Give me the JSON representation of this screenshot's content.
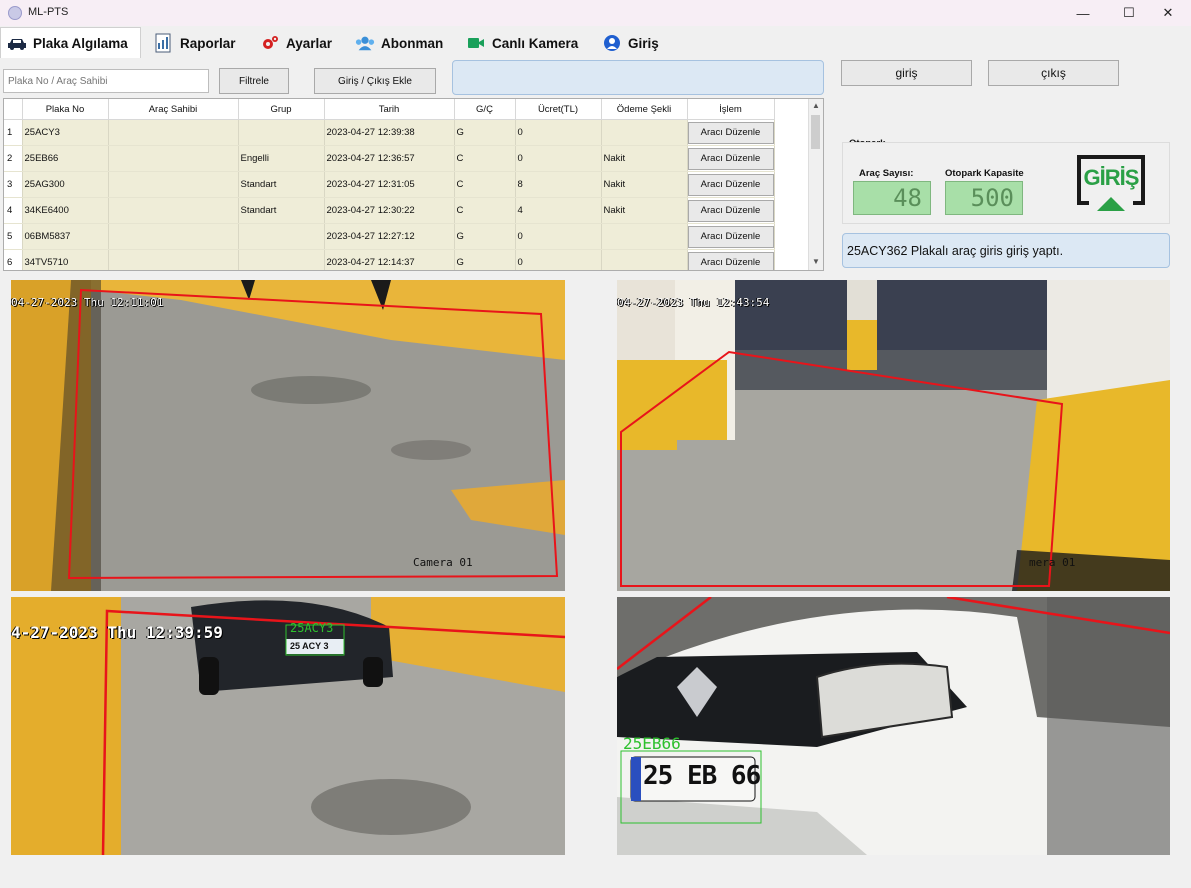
{
  "window": {
    "title": "ML-PTS",
    "minimize": "—",
    "maximize": "☐",
    "close": "✕"
  },
  "tabs": [
    {
      "label": "Plaka Algılama"
    },
    {
      "label": "Raporlar"
    },
    {
      "label": "Ayarlar"
    },
    {
      "label": "Abonman"
    },
    {
      "label": "Canlı Kamera"
    },
    {
      "label": "Giriş"
    }
  ],
  "toolbar": {
    "search_placeholder": "Plaka No / Araç Sahibi",
    "filter_label": "Filtrele",
    "add_entry_exit_label": "Giriş / Çıkış Ekle",
    "entry_button": "giriş",
    "exit_button": "çıkış"
  },
  "table": {
    "columns": [
      "Plaka No",
      "Araç Sahibi",
      "Grup",
      "Tarih",
      "G/Ç",
      "Ücret(TL)",
      "Ödeme Şekli",
      "İşlem"
    ],
    "rows": [
      {
        "idx": "1",
        "plate": "25ACY3",
        "owner": "",
        "group": "",
        "date": "2023-04-27 12:39:38",
        "gc": "G",
        "fee": "0",
        "payment": "",
        "action": "Aracı Düzenle"
      },
      {
        "idx": "2",
        "plate": "25EB66",
        "owner": "",
        "group": "Engelli",
        "date": "2023-04-27 12:36:57",
        "gc": "C",
        "fee": "0",
        "payment": "Nakit",
        "action": "Aracı Düzenle"
      },
      {
        "idx": "3",
        "plate": "25AG300",
        "owner": "",
        "group": "Standart",
        "date": "2023-04-27 12:31:05",
        "gc": "C",
        "fee": "8",
        "payment": "Nakit",
        "action": "Aracı Düzenle"
      },
      {
        "idx": "4",
        "plate": "34KE6400",
        "owner": "",
        "group": "Standart",
        "date": "2023-04-27 12:30:22",
        "gc": "C",
        "fee": "4",
        "payment": "Nakit",
        "action": "Aracı Düzenle"
      },
      {
        "idx": "5",
        "plate": "06BM5837",
        "owner": "",
        "group": "",
        "date": "2023-04-27 12:27:12",
        "gc": "G",
        "fee": "0",
        "payment": "",
        "action": "Aracı Düzenle"
      },
      {
        "idx": "6",
        "plate": "34TV5710",
        "owner": "",
        "group": "",
        "date": "2023-04-27 12:14:37",
        "gc": "G",
        "fee": "0",
        "payment": "",
        "action": "Aracı Düzenle"
      }
    ]
  },
  "otopark": {
    "title": "Otopark",
    "vehicle_count_label": "Araç Sayısı:",
    "vehicle_count": "48",
    "capacity_label": "Otopark Kapasite",
    "capacity": "500",
    "logo_text": "GİRİŞ"
  },
  "status_message": "25ACY362 Plakalı araç giris giriş yaptı.",
  "cameras": [
    {
      "osd": "04-27-2023 Thu 12:11:01",
      "name": "Camera 01"
    },
    {
      "osd": "04-27-2023 Thu 12:43:54",
      "name": "Camera 01",
      "name_partial": "mera 01"
    },
    {
      "osd": "4-27-2023 Thu 12:39:59",
      "detected_plate": "25ACY3",
      "plate_text": "25 ACY 3"
    },
    {
      "detected_plate": "25EB66",
      "plate_text": "25 EB 66"
    }
  ],
  "colors": {
    "grid_cell": "#efedd8",
    "info_box": "#dce8f4",
    "lcd": "#a8dfa8",
    "roi": "#e8141a",
    "detect": "#2ec02e"
  }
}
